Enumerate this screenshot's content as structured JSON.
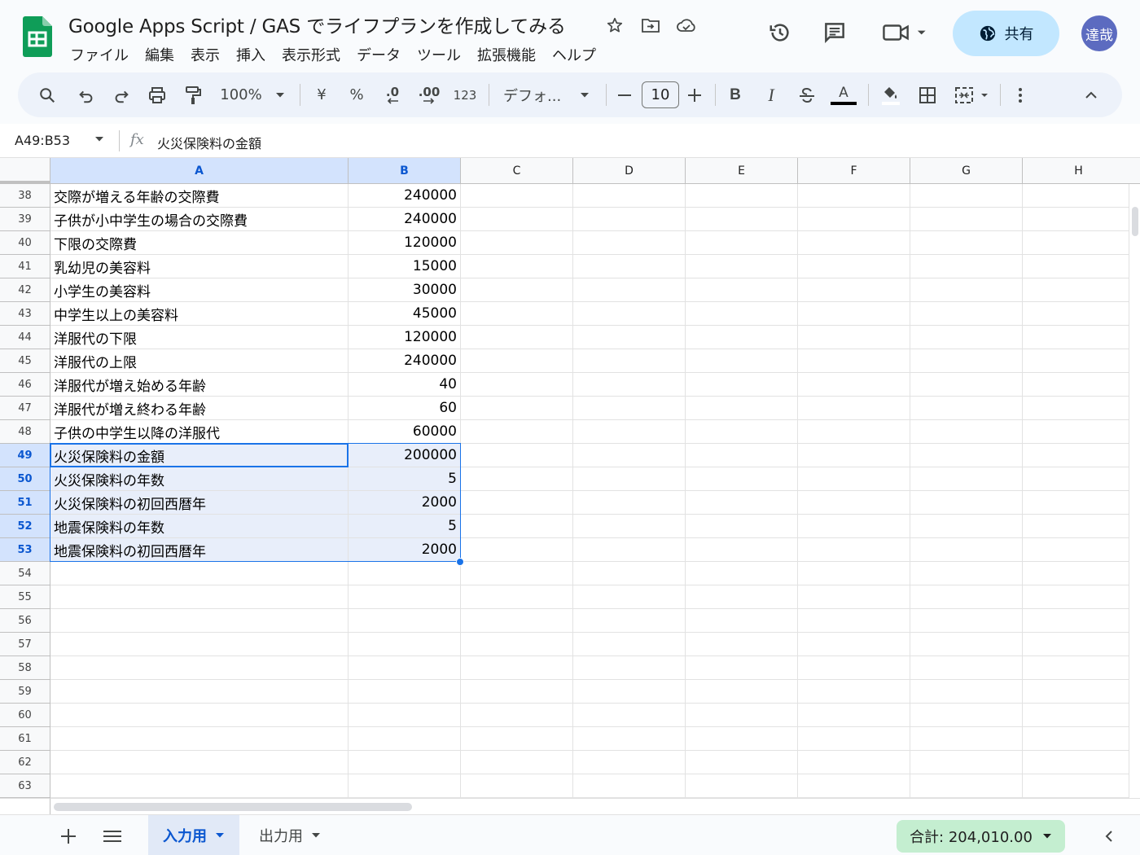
{
  "document": {
    "title": "Google Apps Script / GAS でライフプランを作成してみる"
  },
  "menu": [
    "ファイル",
    "編集",
    "表示",
    "挿入",
    "表示形式",
    "データ",
    "ツール",
    "拡張機能",
    "ヘルプ"
  ],
  "header": {
    "share_label": "共有",
    "avatar_label": "達哉"
  },
  "toolbar": {
    "zoom": "100%",
    "currency": "¥",
    "percent": "%",
    "decrease_decimal": ".0",
    "increase_decimal": ".00",
    "number_format": "123",
    "font": "デフォ...",
    "font_size": "10",
    "bold": "B",
    "italic": "I",
    "text_color_glyph": "A"
  },
  "formula_bar": {
    "name_box": "A49:B53",
    "fx": "fx",
    "content": "火災保険料の金額"
  },
  "columns": [
    "A",
    "B",
    "C",
    "D",
    "E",
    "F",
    "G",
    "H"
  ],
  "rows": [
    {
      "num": "38",
      "a": "交際が増える年齢の交際費",
      "b": "240000"
    },
    {
      "num": "39",
      "a": "子供が小中学生の場合の交際費",
      "b": "240000"
    },
    {
      "num": "40",
      "a": "下限の交際費",
      "b": "120000"
    },
    {
      "num": "41",
      "a": "乳幼児の美容料",
      "b": "15000"
    },
    {
      "num": "42",
      "a": "小学生の美容料",
      "b": "30000"
    },
    {
      "num": "43",
      "a": "中学生以上の美容料",
      "b": "45000"
    },
    {
      "num": "44",
      "a": "洋服代の下限",
      "b": "120000"
    },
    {
      "num": "45",
      "a": "洋服代の上限",
      "b": "240000"
    },
    {
      "num": "46",
      "a": "洋服代が増え始める年齢",
      "b": "40"
    },
    {
      "num": "47",
      "a": "洋服代が増え終わる年齢",
      "b": "60"
    },
    {
      "num": "48",
      "a": "子供の中学生以降の洋服代",
      "b": "60000"
    },
    {
      "num": "49",
      "a": "火災保険料の金額",
      "b": "200000"
    },
    {
      "num": "50",
      "a": "火災保険料の年数",
      "b": "5"
    },
    {
      "num": "51",
      "a": "火災保険料の初回西暦年",
      "b": "2000"
    },
    {
      "num": "52",
      "a": "地震保険料の年数",
      "b": "5"
    },
    {
      "num": "53",
      "a": "地震保険料の初回西暦年",
      "b": "2000"
    },
    {
      "num": "54",
      "a": "",
      "b": ""
    },
    {
      "num": "55",
      "a": "",
      "b": ""
    },
    {
      "num": "56",
      "a": "",
      "b": ""
    },
    {
      "num": "57",
      "a": "",
      "b": ""
    },
    {
      "num": "58",
      "a": "",
      "b": ""
    },
    {
      "num": "59",
      "a": "",
      "b": ""
    },
    {
      "num": "60",
      "a": "",
      "b": ""
    },
    {
      "num": "61",
      "a": "",
      "b": ""
    },
    {
      "num": "62",
      "a": "",
      "b": ""
    },
    {
      "num": "63",
      "a": "",
      "b": ""
    }
  ],
  "selection": {
    "first_row": "49",
    "last_row": "53",
    "columns": [
      "A",
      "B"
    ]
  },
  "sheets": [
    {
      "name": "入力用",
      "active": true
    },
    {
      "name": "出力用",
      "active": false
    }
  ],
  "status": {
    "sum": "合計: 204,010.00"
  },
  "colors": {
    "accent": "#1a73e8",
    "share_bg": "#c2e7ff",
    "sum_bg": "#c4eed0",
    "selection_fill": "#e8eefa",
    "header_selected": "#d3e3fd",
    "sheets_green": "#0f9d58"
  },
  "icons": {
    "logo": "sheets-logo-icon",
    "star": "star-icon",
    "move": "move-to-folder-icon",
    "cloud": "cloud-status-icon",
    "history": "history-icon",
    "comments": "comment-icon",
    "meet": "video-call-icon",
    "share": "globe-icon"
  }
}
